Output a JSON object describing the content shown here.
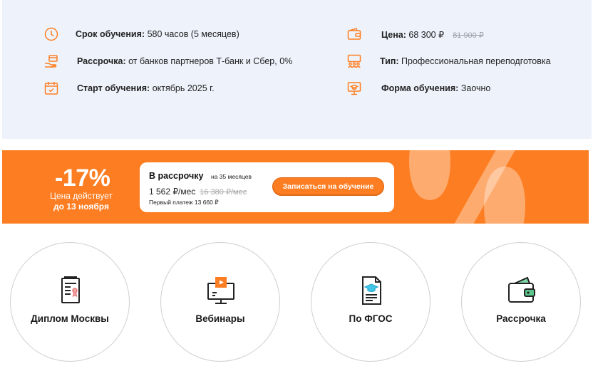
{
  "info": {
    "duration": {
      "label": "Срок обучения:",
      "value": "580 часов (5 месяцев)"
    },
    "installment": {
      "label": "Рассрочка:",
      "value": "от банков партнеров Т-банк и Сбер, 0%"
    },
    "start": {
      "label": "Старт обучения:",
      "value": "октябрь 2025 г."
    },
    "price": {
      "label": "Цена:",
      "value": "68 300 ₽",
      "old": "81 900 ₽"
    },
    "type": {
      "label": "Тип:",
      "value": "Профессиональная переподготовка"
    },
    "form": {
      "label": "Форма обучения:",
      "value": "Заочно"
    }
  },
  "promo": {
    "discount": "-17%",
    "valid_text": "Цена действует",
    "valid_date": "до 13 ноября",
    "installment_title": "В рассрочку",
    "installment_term": "на 35 месяцев",
    "monthly": "1 562 ₽/мес",
    "monthly_old": "16 380 ₽/мес",
    "first_payment": "Первый платеж 13 660 ₽",
    "cta": "Записаться на обучение"
  },
  "features": [
    {
      "label": "Диплом Москвы",
      "icon": "diploma-icon"
    },
    {
      "label": "Вебинары",
      "icon": "webinar-icon"
    },
    {
      "label": "По ФГОС",
      "icon": "fgos-document-icon"
    },
    {
      "label": "Рассрочка",
      "icon": "wallet-icon"
    }
  ],
  "colors": {
    "accent": "#fd7e22",
    "panel": "#eef3fb",
    "text": "#222222"
  }
}
